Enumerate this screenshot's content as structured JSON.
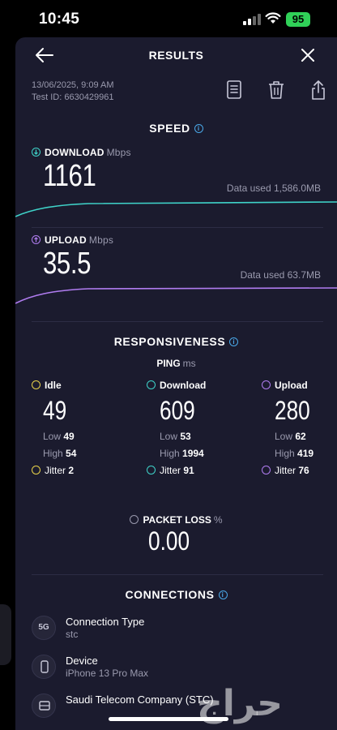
{
  "status": {
    "time": "10:45",
    "battery": "95"
  },
  "header": {
    "title": "RESULTS"
  },
  "meta": {
    "datetime": "13/06/2025, 9:09 AM",
    "test_id": "Test ID: 6630429961"
  },
  "speed": {
    "title": "SPEED",
    "download": {
      "label": "DOWNLOAD",
      "unit": "Mbps",
      "value": "1161",
      "data_used": "Data used 1,586.0MB",
      "color": "#3fd3c9"
    },
    "upload": {
      "label": "UPLOAD",
      "unit": "Mbps",
      "value": "35.5",
      "data_used": "Data used 63.7MB",
      "color": "#b07cf0"
    }
  },
  "responsiveness": {
    "title": "RESPONSIVENESS",
    "ping_label": "PING",
    "ping_unit": "ms",
    "columns": [
      {
        "label": "Idle",
        "value": "49",
        "low_label": "Low",
        "low": "49",
        "high_label": "High",
        "high": "54",
        "jitter_label": "Jitter",
        "jitter": "2",
        "color": "#e8d24a"
      },
      {
        "label": "Download",
        "value": "609",
        "low_label": "Low",
        "low": "53",
        "high_label": "High",
        "high": "1994",
        "jitter_label": "Jitter",
        "jitter": "91",
        "color": "#3fd3c9"
      },
      {
        "label": "Upload",
        "value": "280",
        "low_label": "Low",
        "low": "62",
        "high_label": "High",
        "high": "419",
        "jitter_label": "Jitter",
        "jitter": "76",
        "color": "#b07cf0"
      }
    ]
  },
  "packet_loss": {
    "label": "PACKET LOSS",
    "unit": "%",
    "value": "0.00"
  },
  "connections": {
    "title": "CONNECTIONS",
    "items": [
      {
        "icon": "5G",
        "title": "Connection Type",
        "value": "stc"
      },
      {
        "icon": "phone-icon",
        "title": "Device",
        "value": "iPhone 13 Pro Max"
      },
      {
        "icon": "server-icon",
        "title": "Saudi Telecom Company (STC)",
        "value": ""
      }
    ]
  },
  "watermark": "حراج",
  "colors": {
    "accent": "#4aa8e8",
    "sheet": "#1b1b2e"
  }
}
